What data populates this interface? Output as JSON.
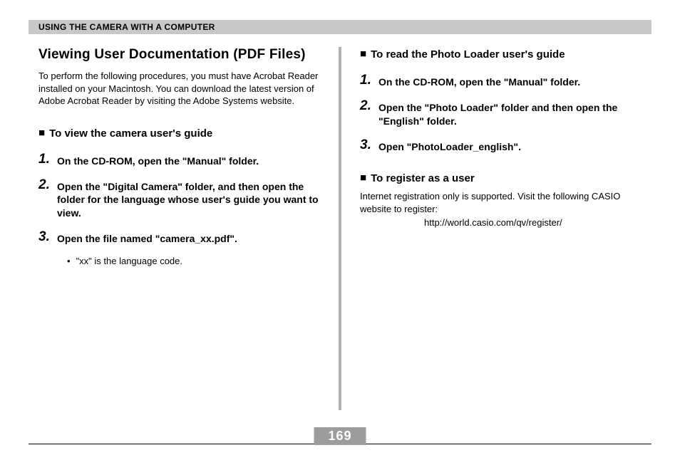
{
  "header": "USING THE CAMERA WITH A COMPUTER",
  "page_number": "169",
  "left": {
    "title": "Viewing User Documentation (PDF Files)",
    "intro": "To perform the following procedures, you must have Acrobat Reader installed on your Macintosh. You can download the latest version of Adobe Acrobat Reader by visiting the Adobe Systems website.",
    "sub1": "To view the camera user's guide",
    "steps1": [
      "On the CD-ROM, open the \"Manual\" folder.",
      "Open the  \"Digital Camera\" folder, and then open the folder for the language whose user's guide you want to view.",
      "Open the file named \"camera_xx.pdf\"."
    ],
    "bullet1": "\"xx\" is the language code."
  },
  "right": {
    "sub1": "To read the Photo Loader user's guide",
    "steps1": [
      "On the CD-ROM, open the \"Manual\" folder.",
      "Open the \"Photo Loader\" folder and then open the \"English\" folder.",
      "Open \"PhotoLoader_english\"."
    ],
    "sub2": "To register as a user",
    "reg_text": "Internet registration only is supported. Visit the following CASIO website to register:",
    "reg_url": "http://world.casio.com/qv/register/"
  }
}
